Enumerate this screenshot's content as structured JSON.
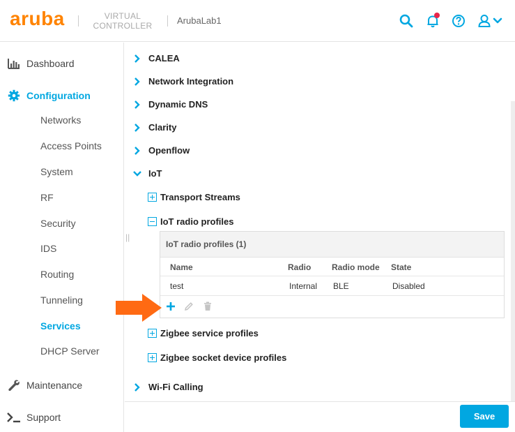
{
  "header": {
    "logo_text": "aruba",
    "product_line1": "VIRTUAL",
    "product_line2": "CONTROLLER",
    "cluster_name": "ArubaLab1",
    "icons": [
      "search-icon",
      "notifications-icon",
      "help-icon",
      "user-icon",
      "chevron-down-icon"
    ],
    "accent_color": "#01a7e1",
    "brand_color": "#ff8300"
  },
  "sidebar": {
    "dashboard": "Dashboard",
    "configuration": "Configuration",
    "items": [
      {
        "label": "Networks"
      },
      {
        "label": "Access Points"
      },
      {
        "label": "System"
      },
      {
        "label": "RF"
      },
      {
        "label": "Security"
      },
      {
        "label": "IDS"
      },
      {
        "label": "Routing"
      },
      {
        "label": "Tunneling"
      },
      {
        "label": "Services",
        "active": true
      },
      {
        "label": "DHCP Server"
      }
    ],
    "maintenance": "Maintenance",
    "support": "Support"
  },
  "main": {
    "sections": [
      {
        "label": "CALEA",
        "expanded": false
      },
      {
        "label": "Network Integration",
        "expanded": false
      },
      {
        "label": "Dynamic DNS",
        "expanded": false
      },
      {
        "label": "Clarity",
        "expanded": false
      },
      {
        "label": "Openflow",
        "expanded": false
      },
      {
        "label": "IoT",
        "expanded": true
      },
      {
        "label": "Wi-Fi Calling",
        "expanded": false
      }
    ],
    "iot": {
      "transport_streams": "Transport Streams",
      "radio_profiles": "IoT radio profiles",
      "zigbee_service": "Zigbee service profiles",
      "zigbee_socket": "Zigbee socket device profiles",
      "table": {
        "title": "IoT radio profiles (1)",
        "columns": [
          "Name",
          "Radio",
          "Radio mode",
          "State"
        ],
        "rows": [
          [
            "test",
            "Internal",
            "BLE",
            "Disabled"
          ]
        ]
      }
    }
  },
  "footer": {
    "save_label": "Save"
  },
  "annotation": {
    "arrow_color": "#ff6a13"
  }
}
